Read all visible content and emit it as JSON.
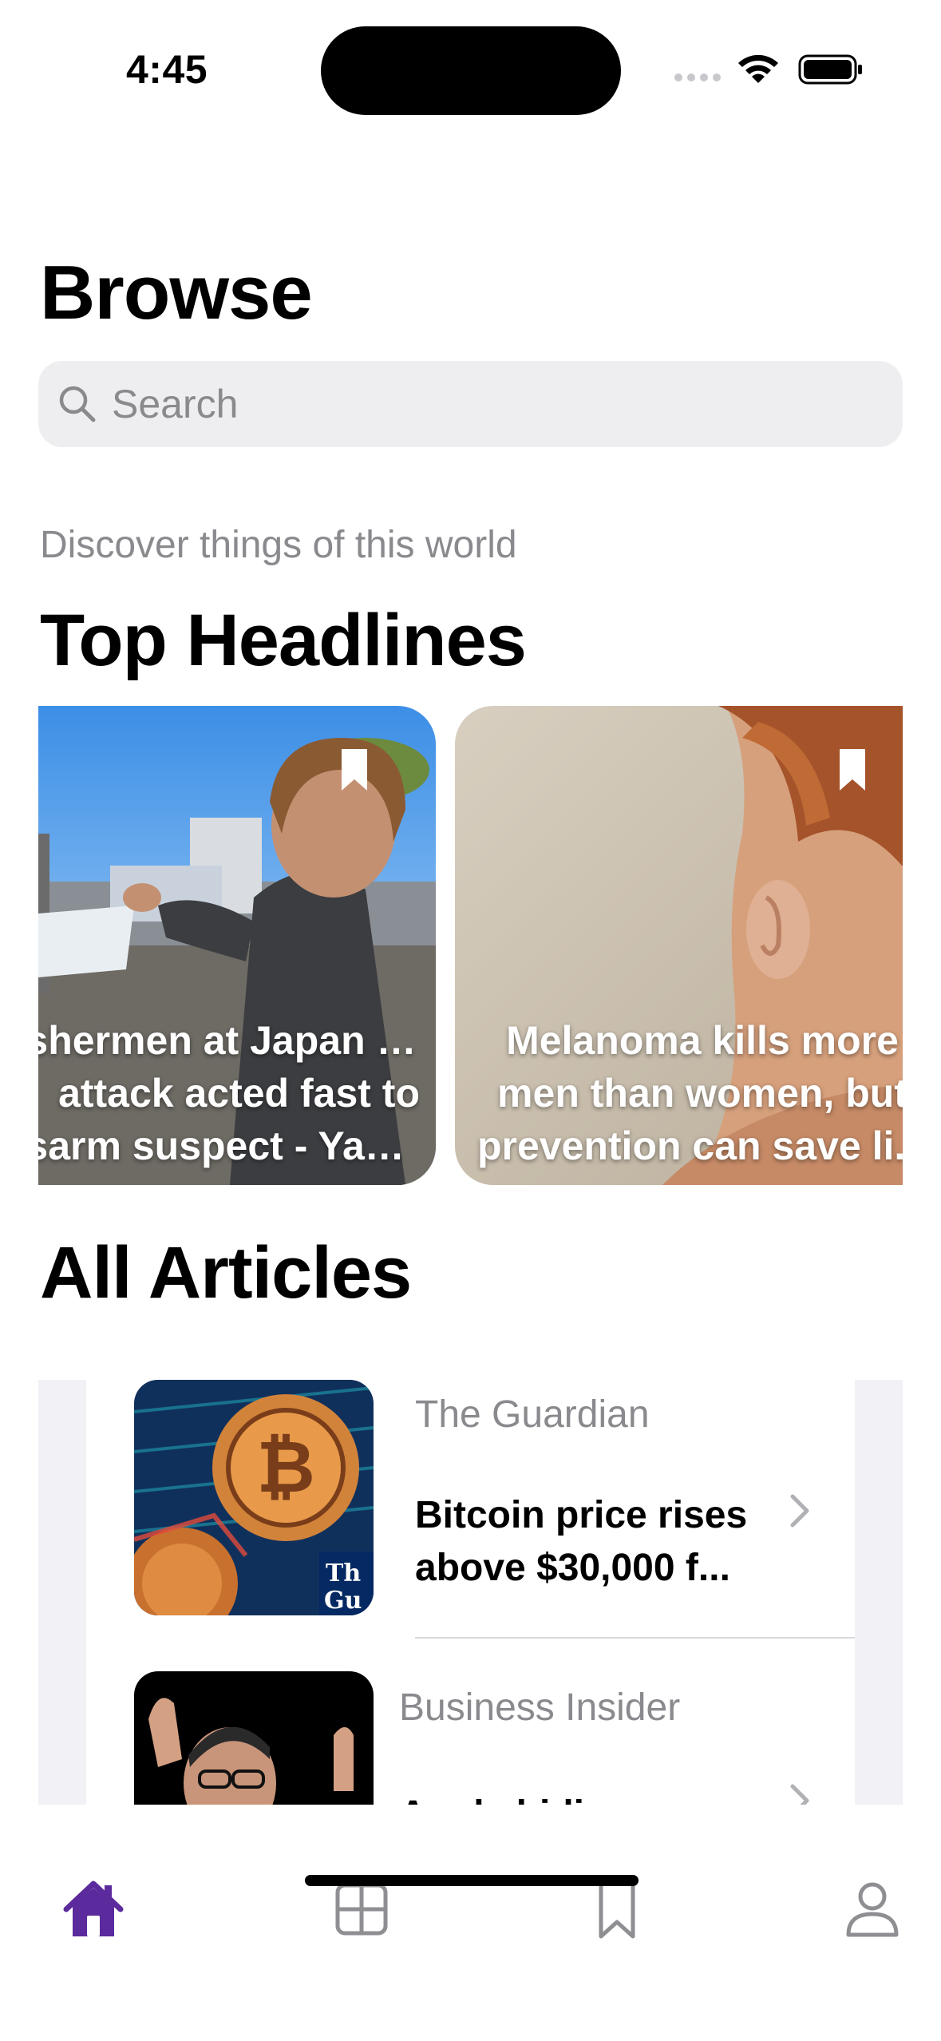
{
  "status_bar": {
    "time": "4:45"
  },
  "header": {
    "title": "Browse"
  },
  "search": {
    "placeholder": "Search"
  },
  "subtitle": "Discover things of this world",
  "top_headlines": {
    "title": "Top Headlines",
    "cards": [
      {
        "lines": [
          "Fishermen at Japan PM",
          "attack acted fast to",
          "disarm suspect - Yah..."
        ]
      },
      {
        "lines": [
          "Melanoma kills more",
          "men than women, but",
          "prevention can save li..."
        ]
      }
    ]
  },
  "all_articles": {
    "title": "All Articles",
    "items": [
      {
        "source": "The Guardian",
        "headline_lines": [
          "Bitcoin price rises",
          "above $30,000 f..."
        ]
      },
      {
        "source": "Business Insider",
        "headline_lines": [
          "Apple hiding a",
          ""
        ]
      }
    ]
  },
  "tab_bar": {
    "tabs": [
      {
        "icon": "house-icon",
        "active": true
      },
      {
        "icon": "grid-icon",
        "active": false
      },
      {
        "icon": "bookmark-icon",
        "active": false
      },
      {
        "icon": "person-icon",
        "active": false
      }
    ],
    "accent_color": "#5b2a9c",
    "inactive_color": "#8e8e93"
  }
}
